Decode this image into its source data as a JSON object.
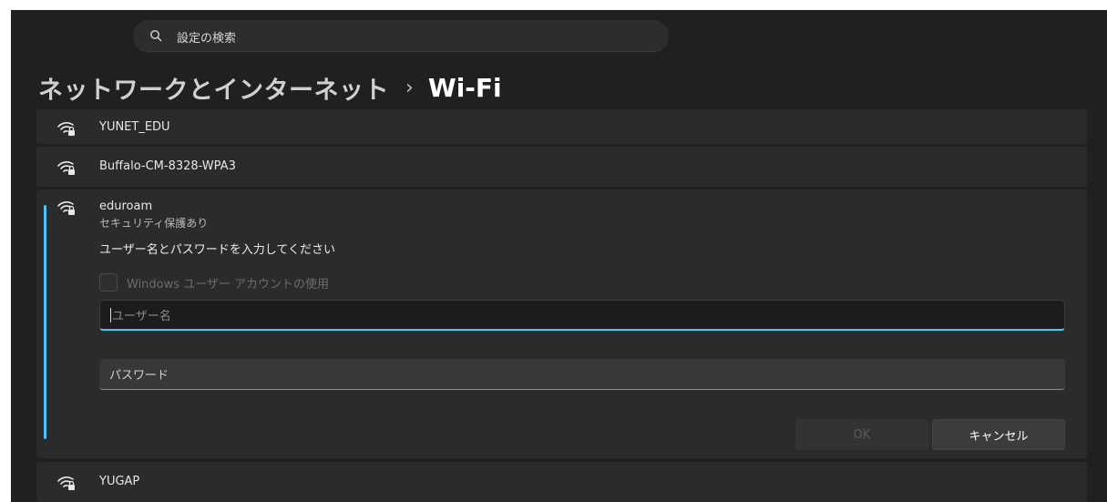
{
  "search": {
    "placeholder": "設定の検索"
  },
  "header": {
    "breadcrumb_parent": "ネットワークとインターネット",
    "separator": "›",
    "current_page": "Wi-Fi"
  },
  "networks": [
    {
      "name": "YUNET_EDU",
      "icon": "wifi-secured-icon"
    },
    {
      "name": "Buffalo-CM-8328-WPA3",
      "icon": "wifi-secured-icon"
    },
    {
      "name": "YUGAP",
      "icon": "wifi-secured-icon"
    }
  ],
  "selected_network": {
    "name": "eduroam",
    "status": "セキュリティ保護あり",
    "prompt": "ユーザー名とパスワードを入力してください",
    "use_windows_account_label": "Windows ユーザー アカウントの使用",
    "use_windows_account_checked": false,
    "username_placeholder": "ユーザー名",
    "username_value": "",
    "password_placeholder": "パスワード",
    "ok_label": "OK",
    "cancel_label": "キャンセル"
  },
  "colors": {
    "background": "#202020",
    "card": "#2b2b2b",
    "accent": "#4cc2ff",
    "text": "#ffffff"
  }
}
